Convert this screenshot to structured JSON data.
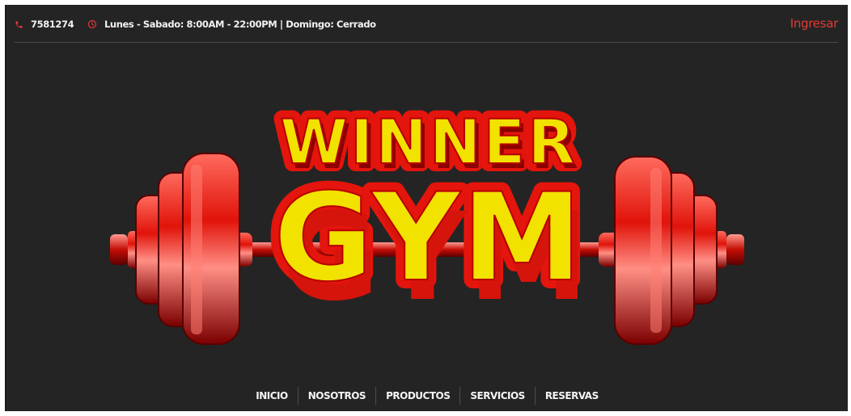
{
  "topbar": {
    "phone": "7581274",
    "hours": "Lunes - Sabado: 8:00AM - 22:00PM | Domingo: Cerrado",
    "login": "Ingresar",
    "phone_icon": "phone-icon",
    "clock_icon": "clock-icon"
  },
  "logo": {
    "line1": "WINNER",
    "line2": "GYM",
    "colors": {
      "text": "#f2e200",
      "outline": "#e3150c",
      "shadow": "#8b0000"
    }
  },
  "nav": {
    "items": [
      {
        "label": "INICIO"
      },
      {
        "label": "NOSOTROS"
      },
      {
        "label": "PRODUCTOS"
      },
      {
        "label": "SERVICIOS"
      },
      {
        "label": "RESERVAS"
      }
    ]
  },
  "colors": {
    "accent": "#e53935",
    "background": "#242424"
  }
}
